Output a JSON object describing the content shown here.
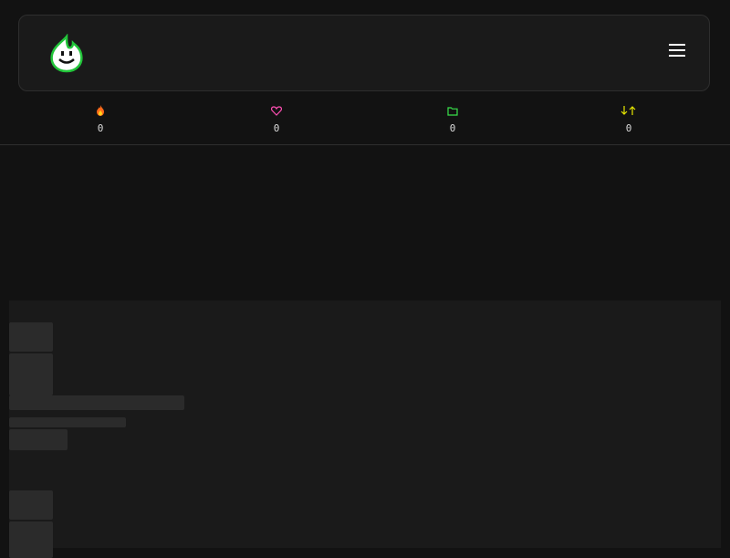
{
  "header": {
    "logo_icon": "smiling-flame-logo-icon",
    "menu_icon": "hamburger-menu-icon"
  },
  "stats": [
    {
      "icon": "fire-icon",
      "color": "#ff6a1a",
      "count": "0"
    },
    {
      "icon": "heart-icon",
      "color": "#ff4fb3",
      "count": "0"
    },
    {
      "icon": "folder-icon",
      "color": "#39e04a",
      "count": "0"
    },
    {
      "icon": "sort-arrows-icon",
      "color": "#e6e600",
      "count": "0"
    }
  ],
  "colors": {
    "background": "#121212",
    "panel": "#1a1a1a",
    "skeleton": "#2b2b2b",
    "logo_outline": "#22c53a"
  }
}
